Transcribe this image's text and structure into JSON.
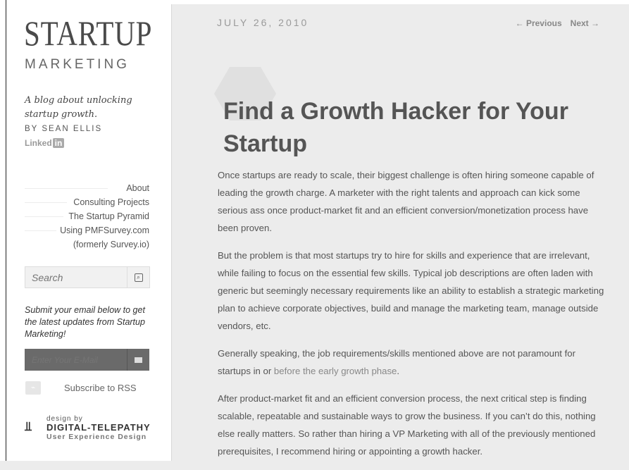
{
  "site": {
    "logo_main": "STARTUP",
    "logo_sub": "MARKETING",
    "tagline": "A blog about unlocking startup growth.",
    "byline": "BY SEAN ELLIS",
    "linkedin_label": "Linked",
    "linkedin_badge": "in"
  },
  "nav": [
    {
      "label": "About"
    },
    {
      "label": "Consulting Projects"
    },
    {
      "label": "The Startup Pyramid"
    },
    {
      "label": "Using PMFSurvey.com"
    },
    {
      "label": "(formerly Survey.io)"
    }
  ],
  "search": {
    "placeholder": "Search"
  },
  "subscribe": {
    "text": "Submit your email below to get the latest updates from Startup Marketing!",
    "email_placeholder": "Enter Your E-Mail",
    "rss_label": "Subscribe to RSS"
  },
  "credit": {
    "by": "design by",
    "name": "DIGITAL-TELEPATHY",
    "desc": "User Experience Design"
  },
  "post": {
    "date": "JULY 26, 2010",
    "previous": "← Previous",
    "next": "Next →",
    "title": "Find a Growth Hacker for Your Startup",
    "p1": "Once startups are ready to scale, their biggest challenge is often hiring someone capable of leading the growth charge.  A marketer with the right talents and approach can kick some serious ass once product-market fit and an efficient conversion/monetization process have been proven.",
    "p2": "But the problem is that most startups try to hire for skills and experience that are irrelevant, while failing to focus on the essential few skills.  Typical job descriptions are often laden with generic but seemingly necessary requirements like an ability to establish a strategic marketing plan to achieve corporate objectives, build and manage the marketing team, manage outside vendors, etc.",
    "p3_text": "Generally speaking, the job requirements/skills mentioned above are not paramount for startups in or ",
    "p3_link": "before the early growth phase",
    "p3_end": ".",
    "p4": "After product-market fit and an efficient conversion process, the next critical step is finding scalable, repeatable and sustainable ways to grow the business.  If you can’t do this, nothing else really matters. So rather than hiring a VP Marketing with all of the previously mentioned prerequisites, I recommend hiring or appointing a growth hacker."
  }
}
